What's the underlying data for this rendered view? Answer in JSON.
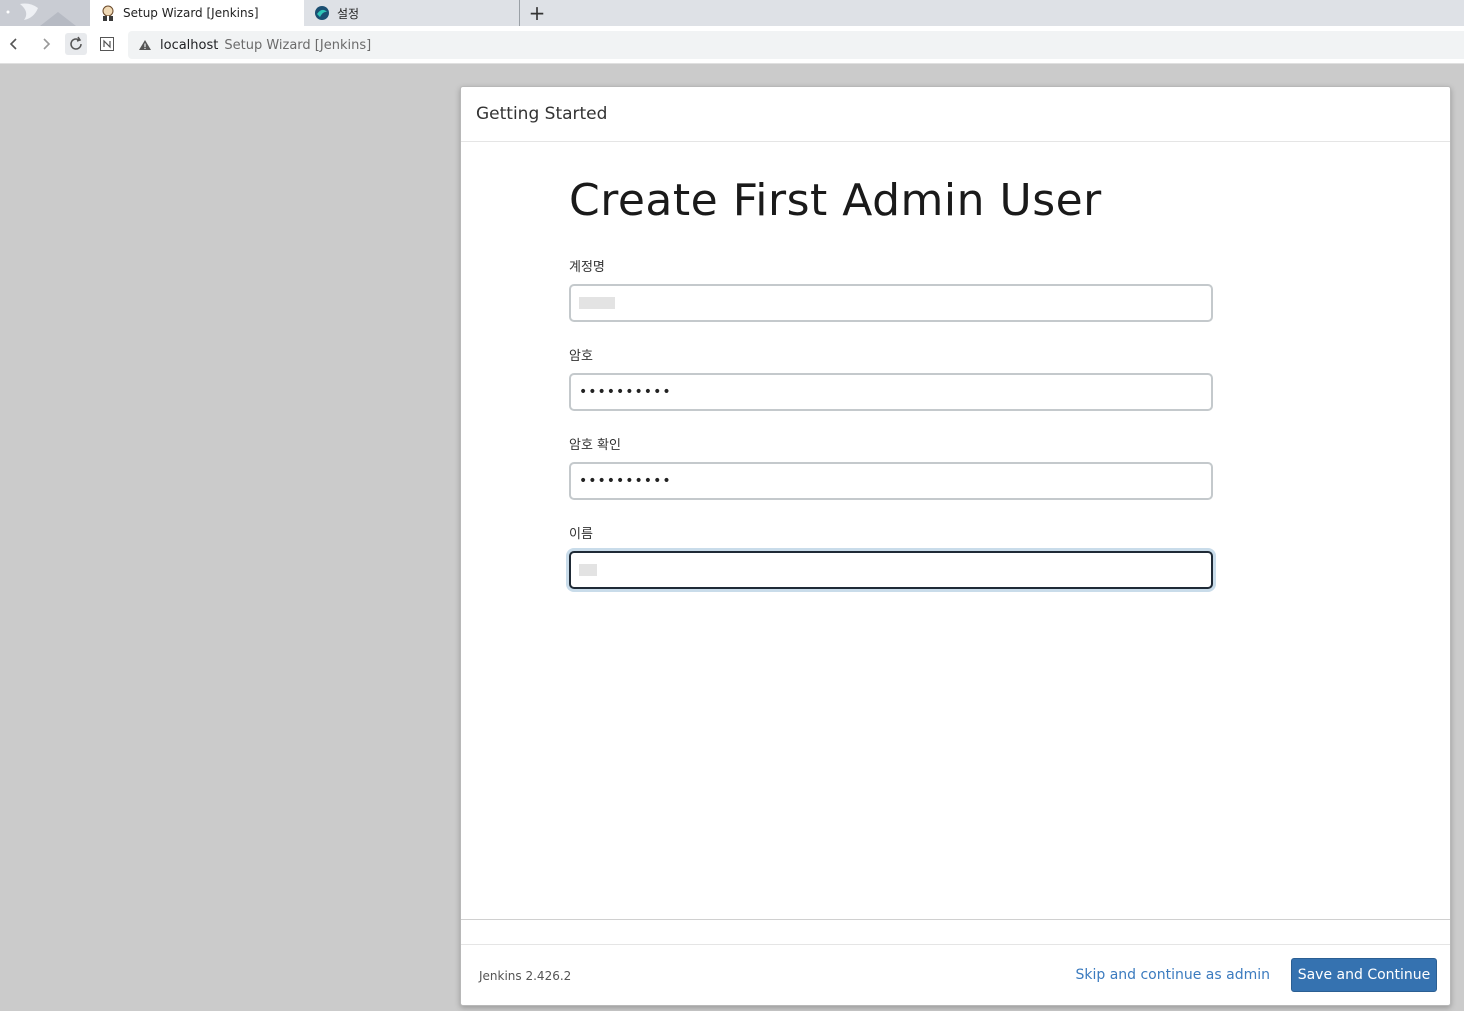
{
  "browser": {
    "tabs": [
      {
        "label": "Setup Wizard [Jenkins]",
        "active": true,
        "icon": "jenkins-butler-icon"
      },
      {
        "label": "설정",
        "active": false,
        "icon": "whale-browser-icon"
      }
    ],
    "new_tab_label": "+",
    "address": {
      "host": "localhost",
      "page_title": "Setup Wizard [Jenkins]",
      "security_icon": "warning-triangle-icon"
    }
  },
  "dialog": {
    "header_title": "Getting Started",
    "heading": "Create First Admin User",
    "fields": [
      {
        "label": "계정명",
        "value": "",
        "masked": false,
        "focused": false
      },
      {
        "label": "암호",
        "value": "••••••••••",
        "masked": true,
        "focused": false
      },
      {
        "label": "암호 확인",
        "value": "••••••••••",
        "masked": true,
        "focused": false
      },
      {
        "label": "이름",
        "value": "",
        "masked": false,
        "focused": true
      }
    ],
    "footer": {
      "version": "Jenkins 2.426.2",
      "skip_label": "Skip and continue as admin",
      "save_label": "Save and Continue"
    }
  },
  "colors": {
    "primary_button": "#3572b0",
    "link": "#3b7bbf",
    "backdrop": "#cbcbcb"
  }
}
